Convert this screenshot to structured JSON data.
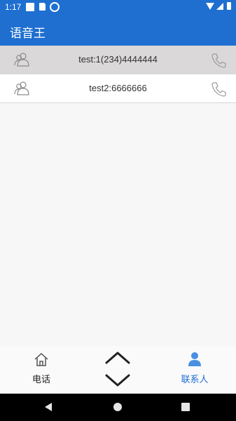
{
  "status_bar": {
    "time": "1:17"
  },
  "app_bar": {
    "title": "语音王"
  },
  "contacts": [
    {
      "text": "test:1(234)4444444",
      "selected": true
    },
    {
      "text": "test2:6666666",
      "selected": false
    }
  ],
  "bottom_nav": {
    "phone_label": "电话",
    "contacts_label": "联系人"
  },
  "colors": {
    "primary": "#1e6fd0",
    "selected_row": "#dad8d8"
  },
  "icons": [
    "person-icon",
    "phone-icon",
    "home-icon",
    "chevron-up-icon",
    "chevron-down-icon",
    "contacts-person-icon"
  ]
}
